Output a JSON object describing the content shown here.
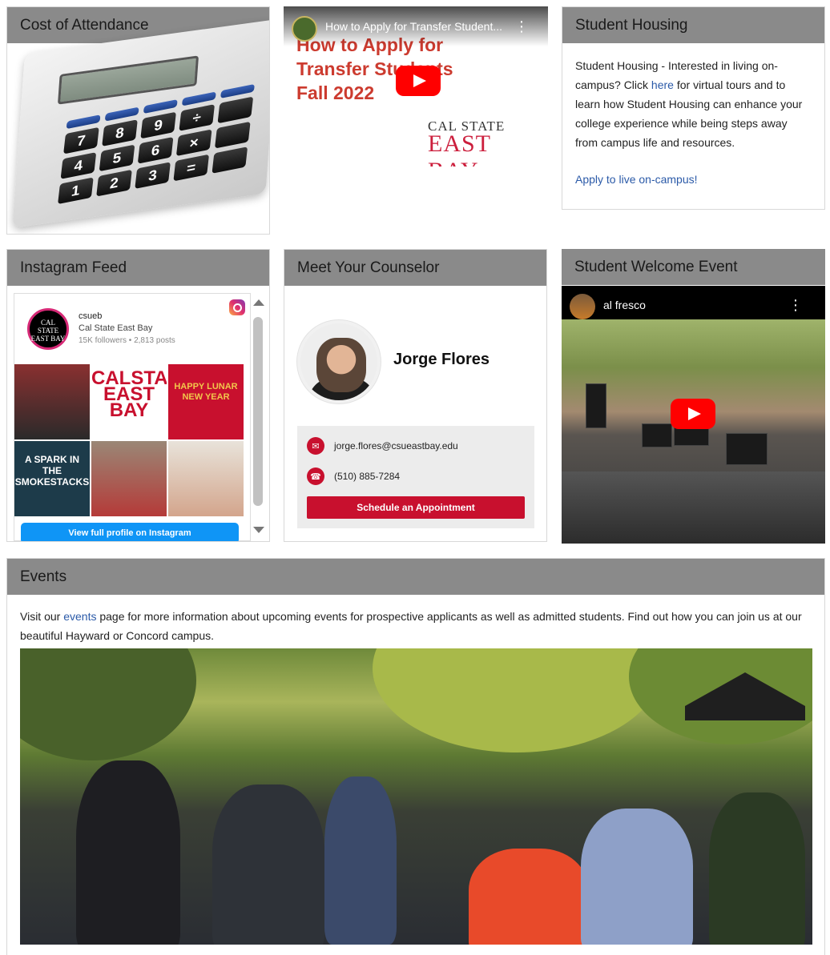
{
  "cost": {
    "title": "Cost of Attendance",
    "calculator_keys": [
      "7",
      "8",
      "9",
      "÷",
      "4",
      "5",
      "6",
      "×",
      "1",
      "2",
      "3",
      "="
    ]
  },
  "video1": {
    "bar_title": "How to Apply for Transfer Student...",
    "title_line1": "How to Apply for",
    "title_line2": "Transfer Students",
    "term": "Fall 2022",
    "logo_top": "CAL STATE",
    "logo_bottom": "EAST BAY"
  },
  "housing": {
    "title": "Student Housing",
    "text_before": "Student Housing - Interested in living on-campus? Click ",
    "link": "here",
    "text_after": " for virtual tours and to learn how Student Housing can enhance your college experience while being steps away from campus life and resources.",
    "apply": "Apply to live on-campus!"
  },
  "instagram": {
    "title": "Instagram Feed",
    "avatar_text": "CAL STATE EAST BAY",
    "handle": "csueb",
    "name": "Cal State East Bay",
    "stats": "15K followers • 2,813 posts",
    "tiles": [
      "",
      "CALSTATE EAST BAY",
      "HAPPY LUNAR NEW YEAR",
      "A SPARK IN THE SMOKESTACKS",
      "",
      ""
    ],
    "button": "View full profile on Instagram"
  },
  "counselor": {
    "title": "Meet Your Counselor",
    "name": "Jorge Flores",
    "email": "jorge.flores@csueastbay.edu",
    "phone": "(510) 885-7284",
    "button": "Schedule an Appointment"
  },
  "welcome": {
    "title": "Student Welcome Event",
    "video_title": "al fresco"
  },
  "events": {
    "title": "Events",
    "text_before": "Visit our ",
    "link": "events",
    "text_after": " page for more information about upcoming events for prospective applicants as well as admitted students. Find out how you can join us at our beautiful Hayward or Concord campus."
  }
}
